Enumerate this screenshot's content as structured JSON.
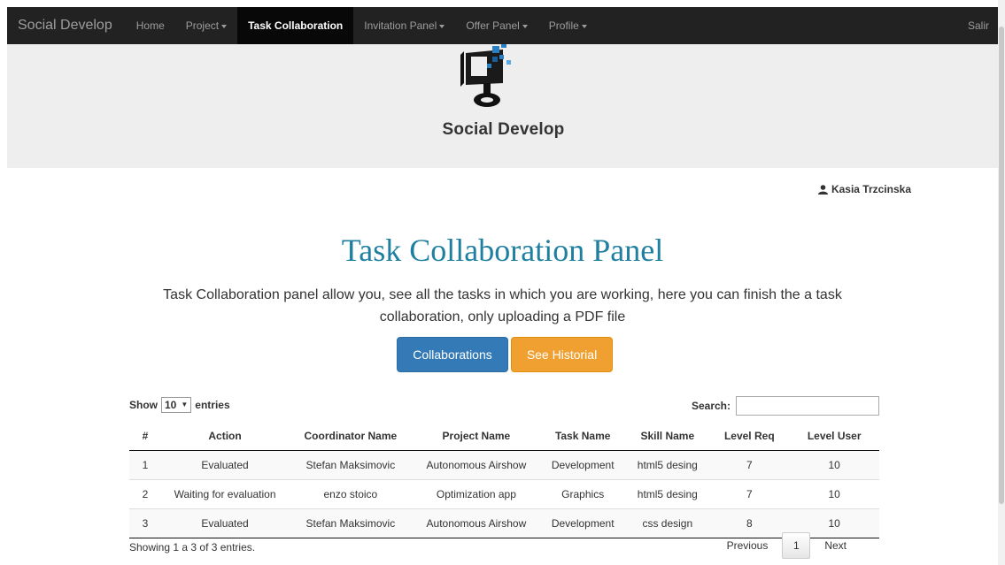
{
  "nav": {
    "brand": "Social Develop",
    "items": [
      {
        "label": "Home",
        "caret": false,
        "active": false
      },
      {
        "label": "Project",
        "caret": true,
        "active": false
      },
      {
        "label": "Task Collaboration",
        "caret": false,
        "active": true
      },
      {
        "label": "Invitation Panel",
        "caret": true,
        "active": false
      },
      {
        "label": "Offer Panel",
        "caret": true,
        "active": false
      },
      {
        "label": "Profile",
        "caret": true,
        "active": false
      }
    ],
    "logout": "Salir"
  },
  "hero": {
    "logo_text": "Social Develop"
  },
  "user": {
    "name": "Kasia Trzcinska",
    "icon": "user-icon"
  },
  "page": {
    "title": "Task Collaboration Panel",
    "description": "Task Collaboration panel allow you, see all the tasks in which you are working, here you can finish the a task collaboration, only uploading a PDF file",
    "btn_collaborations": "Collaborations",
    "btn_historial": "See Historial"
  },
  "table_controls": {
    "show_label": "Show",
    "entries_value": "10",
    "entries_label": "entries",
    "search_label": "Search:",
    "search_value": ""
  },
  "table": {
    "headers": [
      "#",
      "Action",
      "Coordinator Name",
      "Project Name",
      "Task Name",
      "Skill Name",
      "Level Req",
      "Level User"
    ],
    "rows": [
      [
        "1",
        "Evaluated",
        "Stefan Maksimovic",
        "Autonomous Airshow",
        "Development",
        "html5 desing",
        "7",
        "10"
      ],
      [
        "2",
        "Waiting for evaluation",
        "enzo stoico",
        "Optimization app",
        "Graphics",
        "html5 desing",
        "7",
        "10"
      ],
      [
        "3",
        "Evaluated",
        "Stefan Maksimovic",
        "Autonomous Airshow",
        "Development",
        "css design",
        "8",
        "10"
      ]
    ]
  },
  "footer": {
    "info": "Showing 1 a 3 of 3 entries.",
    "previous": "Previous",
    "current_page": "1",
    "next": "Next"
  },
  "colors": {
    "navbar": "#222222",
    "title": "#1e7fa0",
    "primary": "#337ab7",
    "warning": "#f0a030"
  }
}
